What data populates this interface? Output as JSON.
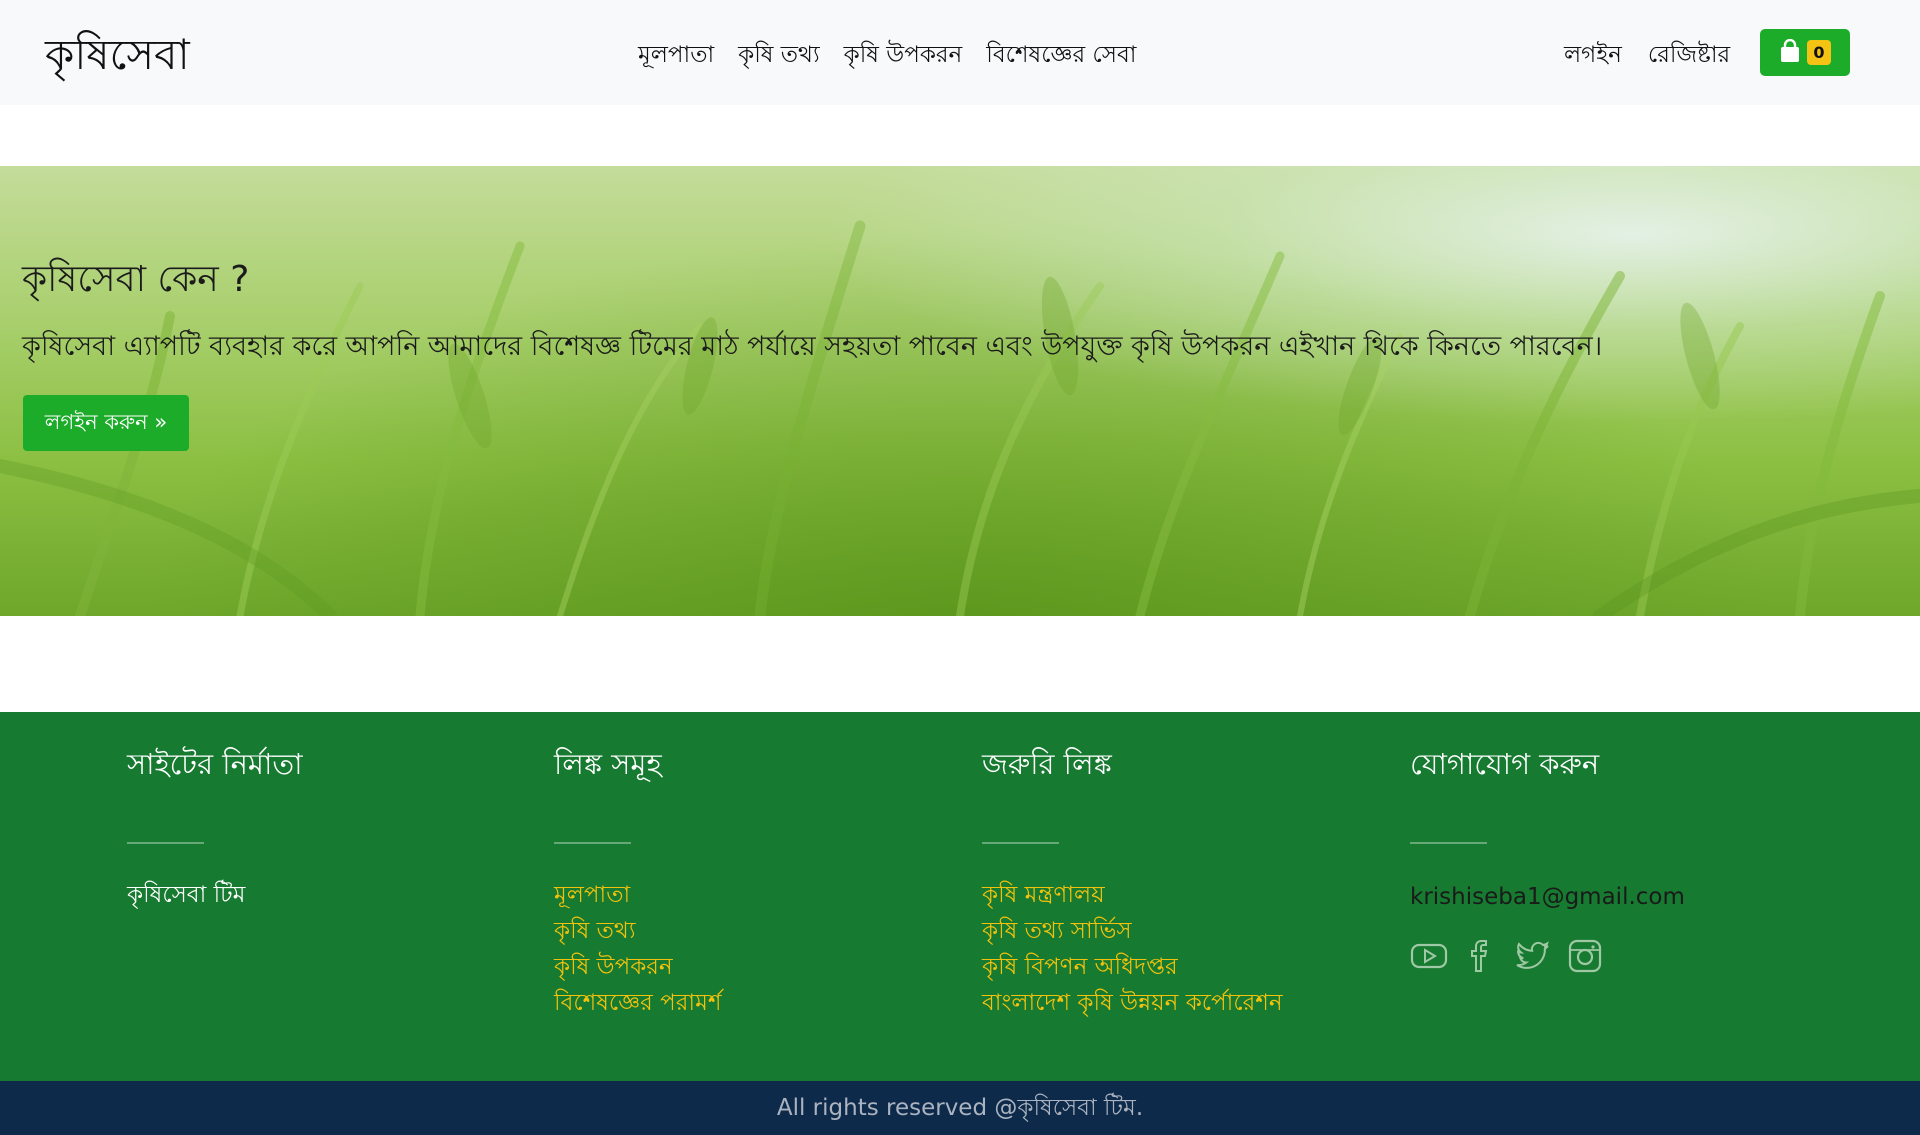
{
  "header": {
    "brand": "কৃষিসেবা",
    "nav": [
      "মূলপাতা",
      "কৃষি তথ্য",
      "কৃষি উপকরন",
      "বিশেষজ্ঞের সেবা"
    ],
    "login": "লগইন",
    "register": "রেজিষ্টার",
    "cart": {
      "icon": "shopping-bag-icon",
      "count": "0"
    }
  },
  "hero": {
    "title": "কৃষিসেবা কেন ?",
    "text": "কৃষিসেবা এ্যাপটি ব্যবহার করে আপনি আমাদের বিশেষজ্ঞ টিমের মাঠ পর্যায়ে সহয়তা পাবেন এবং উপযুক্ত কৃষি উপকরন এইখান থিকে কিনতে পারবেন।",
    "button": "লগইন করুন »"
  },
  "footer": {
    "makers": {
      "heading": "সাইটের নির্মাতা",
      "team": "কৃষিসেবা টিম"
    },
    "links": {
      "heading": "লিঙ্ক সমূহ",
      "items": [
        "মূলপাতা",
        "কৃষি তথ্য",
        "কৃষি উপকরন",
        "বিশেষজ্ঞের পরামর্শ"
      ]
    },
    "important": {
      "heading": "জরুরি লিঙ্ক",
      "items": [
        "কৃষি মন্ত্রণালয়",
        "কৃষি তথ্য সার্ভিস",
        "কৃষি বিপণন অধিদপ্তর",
        "বাংলাদেশ কৃষি উন্নয়ন কর্পোরেশন"
      ]
    },
    "contact": {
      "heading": "যোগাযোগ করুন",
      "email": "krishiseba1@gmail.com",
      "social": [
        "youtube-icon",
        "facebook-icon",
        "twitter-icon",
        "instagram-icon"
      ]
    }
  },
  "copyright": "All rights reserved @কৃষিসেবা টিম.",
  "colors": {
    "primary": "#1dac2a",
    "footer": "#167a30",
    "accent": "#f3c20c",
    "bottom": "#0e2a4b"
  }
}
